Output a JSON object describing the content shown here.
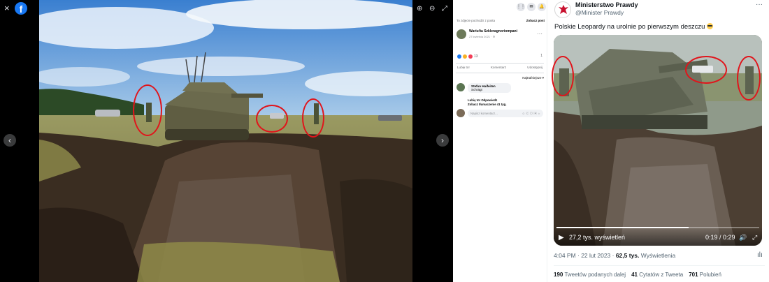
{
  "viewer": {
    "close_glyph": "×",
    "logo_letter": "f",
    "prev_glyph": "‹",
    "next_glyph": "›",
    "zoom_in_glyph": "⊕",
    "zoom_out_glyph": "⊖",
    "fullscreen_glyph": "⤢"
  },
  "fb_post": {
    "top_grid_glyph": "⋮⋮",
    "top_msg_glyph": "✉",
    "top_bell_glyph": "🔔",
    "hint_text": "To zdjęcie pochodzi z posta",
    "hint_link": "Zobacz post",
    "author_name": "Wariu!ta Szkleragnoriompani",
    "author_date": "27 kwietnia 2021 · ⚙",
    "more_glyph": "···",
    "reactions_count": "13",
    "comments_count": "1",
    "actions": [
      "Lubię to!",
      "Komentarz",
      "Udostępnij"
    ],
    "sort_label": "Najtrafniejsze ▾",
    "comment_author": "Stefan Haifeiten",
    "comment_text": "Schrägt",
    "comment_actions_line1": "Lubię to!   Odpowiedz",
    "comment_actions_line2": "Zobacz tłumaczenie   41 tyg.",
    "write_placeholder": "Napisz komentarz...",
    "write_icons": "☺ ⓒ ◎ ▣ ☼"
  },
  "tweet": {
    "name": "Ministerstwo Prawdy",
    "handle": "@Minister Prawdy",
    "more_glyph": "···",
    "text": "Polskie Leopardy na urolnie po pierwszym deszczu ",
    "video_views": "27,2 tys. wyświetleń",
    "video_time": "0:19 / 0:29",
    "progress": 0.65,
    "meta_time": "4:04 PM · 22 lut 2023 · ",
    "meta_views": "62,5 tys.",
    "meta_views_label": " Wyświetlenia",
    "retweets_count": "190",
    "retweets_label": "Tweetów podanych dalej",
    "quotes_count": "41",
    "quotes_label": "Cytatów z Tweeta",
    "likes_count": "701",
    "likes_label": "Polubień"
  },
  "colors": {
    "facebook_blue": "#1877f2",
    "marker_red": "#e1141b"
  }
}
